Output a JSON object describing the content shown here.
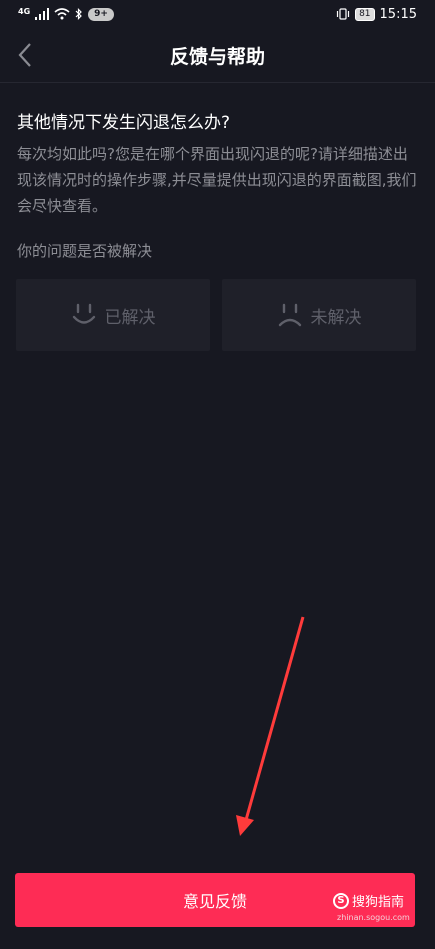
{
  "status_bar": {
    "network": "4G",
    "badge": "9+",
    "battery": "81",
    "time": "15:15"
  },
  "header": {
    "title": "反馈与帮助",
    "back_icon": "chevron-left-icon"
  },
  "faq": {
    "question": "其他情况下发生闪退怎么办?",
    "answer": "每次均如此吗?您是在哪个界面出现闪退的呢?请详细描述出现该情况时的操作步骤,并尽量提供出现闪退的界面截图,我们会尽快查看。"
  },
  "resolution": {
    "label": "你的问题是否被解决",
    "options": [
      {
        "label": "已解决",
        "icon": "smile-face-icon"
      },
      {
        "label": "未解决",
        "icon": "sad-face-icon"
      }
    ]
  },
  "feedback_button": {
    "label": "意见反馈"
  },
  "watermark": {
    "brand": "搜狗指南",
    "url": "zhinan.sogou.com"
  },
  "colors": {
    "background": "#171821",
    "card": "#1f2029",
    "accent": "#fe2c55",
    "annotation": "#ff3b3b"
  }
}
